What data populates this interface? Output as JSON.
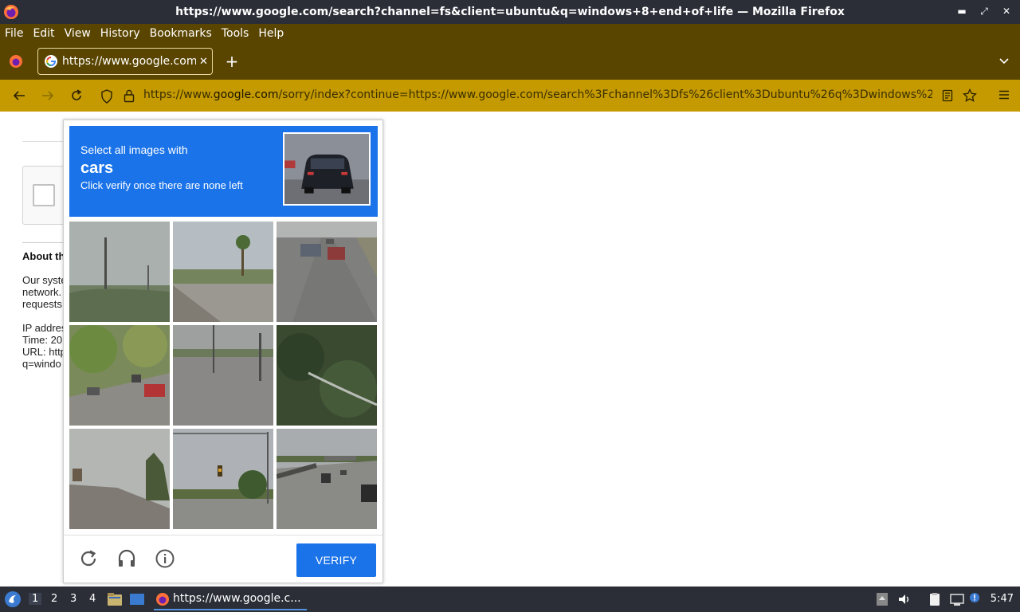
{
  "window": {
    "title": "https://www.google.com/search?channel=fs&client=ubuntu&q=windows+8+end+of+life — Mozilla Firefox",
    "minimize": "▬",
    "maximize": "⤢",
    "close": "✕"
  },
  "menu": {
    "file": "File",
    "edit": "Edit",
    "view": "View",
    "history": "History",
    "bookmarks": "Bookmarks",
    "tools": "Tools",
    "help": "Help"
  },
  "tab": {
    "label": "https://www.google.com/",
    "close": "✕"
  },
  "newtab": "+",
  "url": {
    "prefix": "https://www.",
    "host": "google.com",
    "rest": "/sorry/index?continue=https://www.google.com/search%3Fchannel%3Dfs%26client%3Dubuntu%26q%3Dwindows%2"
  },
  "page": {
    "about": "About th",
    "p1": "Our syste",
    "p2": "network.",
    "p3": "requests",
    "ip": "IP addres",
    "time": "Time: 20",
    "url": "URL: http",
    "q": "q=windo"
  },
  "captcha": {
    "line1": "Select all images with",
    "keyword": "cars",
    "line3": "Click verify once there are none left",
    "verify": "VERIFY"
  },
  "taskbar": {
    "ws1": "1",
    "ws2": "2",
    "ws3": "3",
    "ws4": "4",
    "task": "https://www.google.c...",
    "clock": "5:47"
  },
  "colors": {
    "accent": "#1a73e8",
    "toolbar": "#c49a00",
    "menubar": "#5a4500",
    "titlebar": "#2b2e37"
  }
}
